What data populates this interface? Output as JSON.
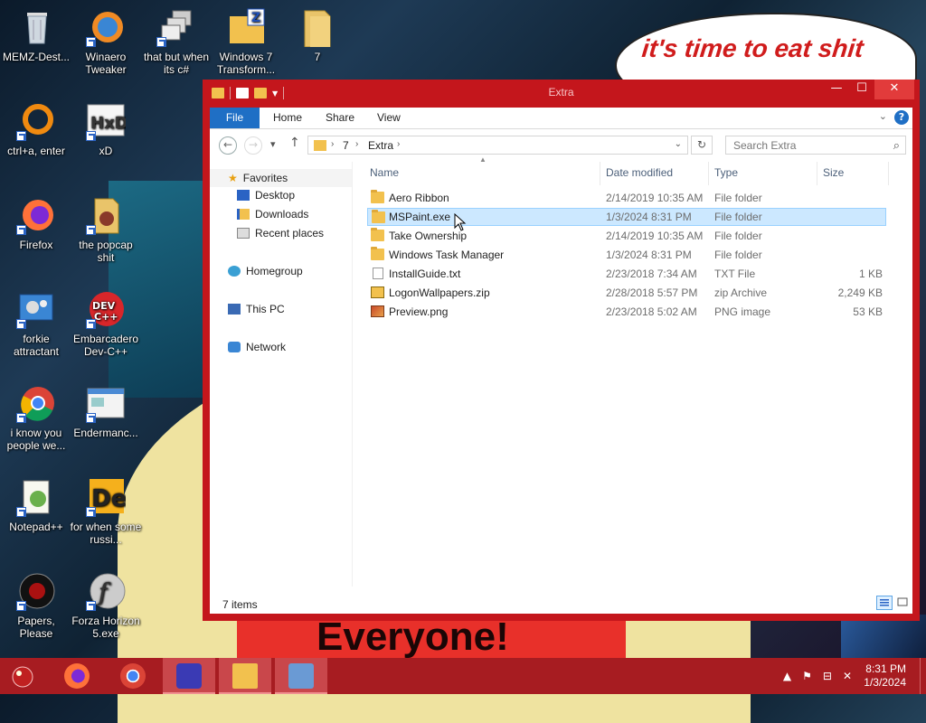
{
  "wallpaper": {
    "speech_text": "it's time to eat shit",
    "banner_text": "Everyone!"
  },
  "desktop_icons": [
    {
      "label": "MEMZ-Dest...",
      "icon": "recycle-bin-icon"
    },
    {
      "label": "Winaero Tweaker",
      "icon": "winaero-tweaker-icon"
    },
    {
      "label": "that but when its c#",
      "icon": "windows-stack-icon"
    },
    {
      "label": "Windows 7 Transform...",
      "icon": "zip-folder-icon"
    },
    {
      "label": "7",
      "icon": "folder-icon"
    },
    {
      "label": "ctrl+a, enter",
      "icon": "orange-ring-icon"
    },
    {
      "label": "xD",
      "icon": "hxd-icon"
    },
    {
      "label": "Firefox",
      "icon": "firefox-icon"
    },
    {
      "label": "the popcap shit",
      "icon": "popcap-icon"
    },
    {
      "label": "forkie attractant",
      "icon": "control-panel-icon"
    },
    {
      "label": "Embarcadero Dev-C++",
      "icon": "devcpp-icon"
    },
    {
      "label": "i know you people we...",
      "icon": "chrome-icon"
    },
    {
      "label": "Endermanc...",
      "icon": "window-app-icon"
    },
    {
      "label": "Notepad++",
      "icon": "notepadpp-icon"
    },
    {
      "label": "for when some russi...",
      "icon": "de-icon"
    },
    {
      "label": "Papers, Please",
      "icon": "papers-please-icon"
    },
    {
      "label": "Forza Horizon 5.exe",
      "icon": "flash-icon"
    }
  ],
  "window": {
    "title": "Extra",
    "ribbon_tabs": [
      "File",
      "Home",
      "Share",
      "View"
    ],
    "breadcrumb": [
      "7",
      "Extra"
    ],
    "search_placeholder": "Search Extra",
    "nav": {
      "favorites": "Favorites",
      "desktop": "Desktop",
      "downloads": "Downloads",
      "recent": "Recent places",
      "homegroup": "Homegroup",
      "thispc": "This PC",
      "network": "Network"
    },
    "columns": {
      "name": "Name",
      "date": "Date modified",
      "type": "Type",
      "size": "Size"
    },
    "files": [
      {
        "name": "Aero Ribbon",
        "date": "2/14/2019 10:35 AM",
        "type": "File folder",
        "size": "",
        "kind": "folder"
      },
      {
        "name": "MSPaint.exe",
        "date": "1/3/2024 8:31 PM",
        "type": "File folder",
        "size": "",
        "kind": "folder"
      },
      {
        "name": "Take Ownership",
        "date": "2/14/2019 10:35 AM",
        "type": "File folder",
        "size": "",
        "kind": "folder"
      },
      {
        "name": "Windows Task Manager",
        "date": "1/3/2024 8:31 PM",
        "type": "File folder",
        "size": "",
        "kind": "folder"
      },
      {
        "name": "InstallGuide.txt",
        "date": "2/23/2018 7:34 AM",
        "type": "TXT File",
        "size": "1 KB",
        "kind": "txt"
      },
      {
        "name": "LogonWallpapers.zip",
        "date": "2/28/2018 5:57 PM",
        "type": "zip Archive",
        "size": "2,249 KB",
        "kind": "zip"
      },
      {
        "name": "Preview.png",
        "date": "2/23/2018 5:02 AM",
        "type": "PNG image",
        "size": "53 KB",
        "kind": "png"
      }
    ],
    "status": "7 items"
  },
  "taskbar": {
    "clock_time": "8:31 PM",
    "clock_date": "1/3/2024"
  },
  "colors": {
    "window_frame": "#c4161c",
    "taskbar": "#a71c21",
    "ribbon_file": "#1f6fc5",
    "selection": "#cce8ff"
  }
}
